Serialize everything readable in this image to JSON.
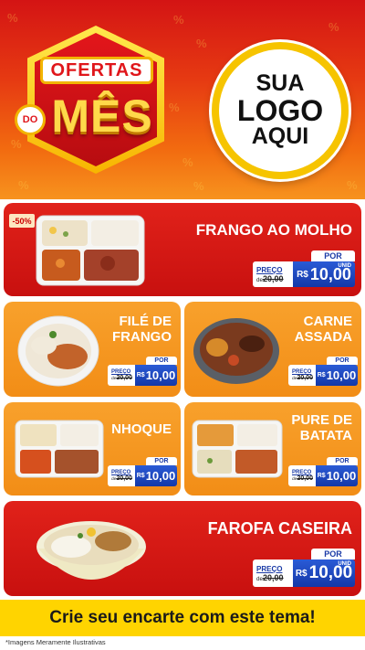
{
  "header": {
    "badge": {
      "top": "OFERTAS",
      "small": "DO",
      "main": "MÊS"
    },
    "logo": {
      "line1": "SUA",
      "line2": "LOGO",
      "line3": "AQUI"
    },
    "colors": {
      "red": "#d41414",
      "orange": "#f7931e",
      "yellow": "#ffd94a"
    }
  },
  "discount_badge": "-50%",
  "products": [
    {
      "name": "FRANGO AO MOLHO",
      "por": "POR",
      "preco_label": "PREÇO",
      "de": "de",
      "old_price": "20,00",
      "currency": "R$",
      "price": "10,00",
      "unit": "UNID"
    },
    {
      "name_line1": "FILÉ DE",
      "name_line2": "FRANGO",
      "por": "POR",
      "preco_label": "PREÇO",
      "de": "de",
      "old_price": "20,00",
      "currency": "R$",
      "price": "10,00"
    },
    {
      "name_line1": "CARNE",
      "name_line2": "ASSADA",
      "por": "POR",
      "preco_label": "PREÇO",
      "de": "de",
      "old_price": "20,00",
      "currency": "R$",
      "price": "10,00"
    },
    {
      "name": "NHOQUE",
      "por": "POR",
      "preco_label": "PREÇO",
      "de": "de",
      "old_price": "20,00",
      "currency": "R$",
      "price": "10,00"
    },
    {
      "name_line1": "PURE DE",
      "name_line2": "BATATA",
      "por": "POR",
      "preco_label": "PREÇO",
      "de": "de",
      "old_price": "20,00",
      "currency": "R$",
      "price": "10,00"
    },
    {
      "name": "FAROFA CASEIRA",
      "por": "POR",
      "preco_label": "PREÇO",
      "de": "de",
      "old_price": "20,00",
      "currency": "R$",
      "price": "10,00",
      "unit": "UNID"
    }
  ],
  "cta": "Crie seu encarte com este tema!",
  "footer": "*Imagens Meramente Ilustrativas",
  "icons": [
    "food-tray-image",
    "food-plate-image",
    "food-bowl-image"
  ]
}
